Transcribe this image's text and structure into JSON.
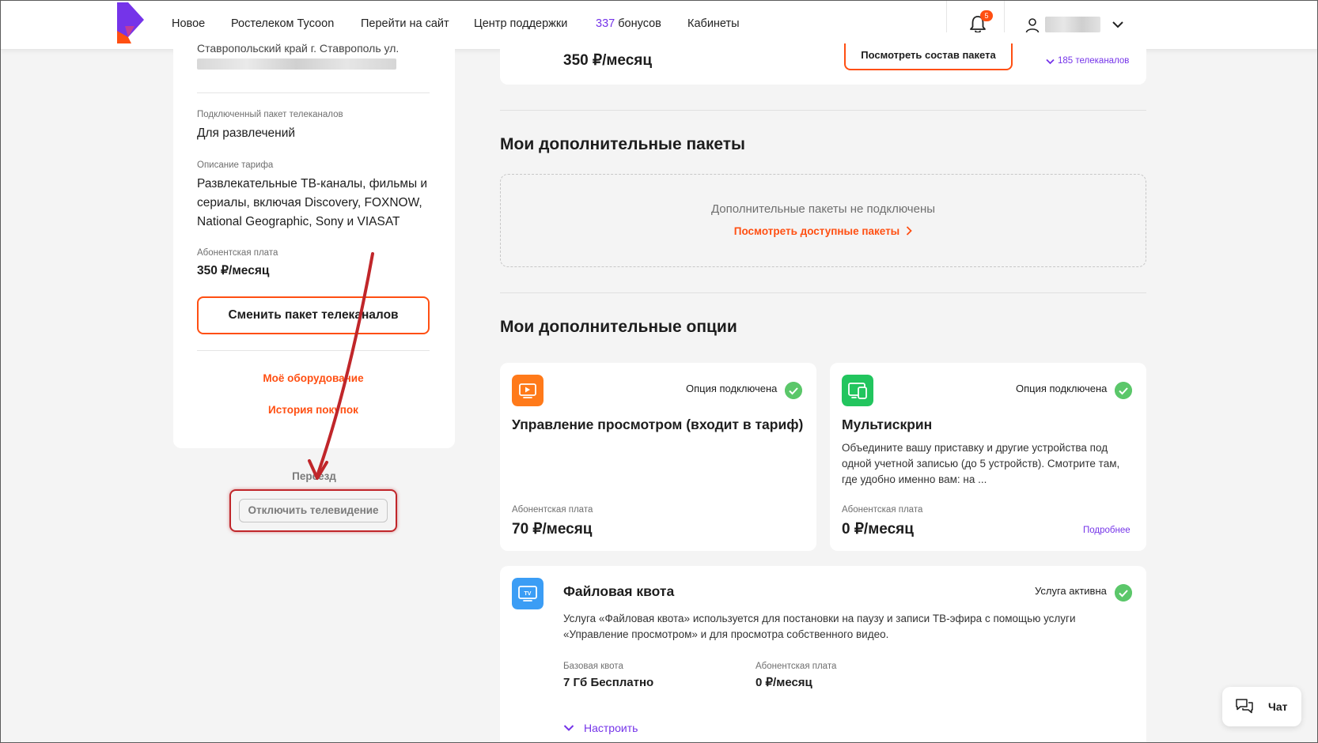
{
  "header": {
    "nav": [
      "Новое",
      "Ростелеком Tycoon",
      "Перейти на сайт",
      "Центр поддержки"
    ],
    "bonus_count": "337",
    "bonus_label": "бонусов",
    "cabinets": "Кабинеты",
    "notifications_badge": "5"
  },
  "sidebar": {
    "address_line": "Ставропольский край г. Ставрополь ул.",
    "package_label": "Подключенный пакет телеканалов",
    "package_value": "Для развлечений",
    "description_label": "Описание тарифа",
    "description_value": "Развлекательные ТВ-каналы, фильмы и сериалы, включая Discovery, FOXNOW, National Geographic, Sony и VIASAT",
    "fee_label": "Абонентская плата",
    "fee_value": "350 ₽/месяц",
    "change_button": "Сменить пакет телеканалов",
    "equipment_link": "Моё оборудование",
    "history_link": "История покупок",
    "move_link": "Переезд",
    "disable_button": "Отключить телевидение"
  },
  "top_card": {
    "price": "350 ₽/месяц",
    "composition_button": "Посмотреть состав пакета",
    "channels_link": "185 телеканалов"
  },
  "addons": {
    "title": "Мои дополнительные пакеты",
    "empty_text": "Дополнительные пакеты не подключены",
    "view_link": "Посмотреть доступные пакеты"
  },
  "options": {
    "title": "Мои дополнительные опции",
    "items": [
      {
        "status": "Опция подключена",
        "title": "Управление просмотром (входит в тариф)",
        "description": "",
        "fee_label": "Абонентская плата",
        "fee": "70 ₽/месяц",
        "icon": "play-screen-icon",
        "icon_color": "#ff7a1a"
      },
      {
        "status": "Опция подключена",
        "title": "Мультискрин",
        "description": "Объедините вашу приставку и другие устройства под одной учетной записью (до 5 устройств). Смотрите там, где удобно именно вам: на ...",
        "fee_label": "Абонентская плата",
        "fee": "0 ₽/месяц",
        "more": "Подробнее",
        "icon": "multiscreen-icon",
        "icon_color": "#22c55e"
      }
    ]
  },
  "quota": {
    "title": "Файловая квота",
    "status": "Услуга активна",
    "description": "Услуга «Файловая квота» используется для постановки на паузу и записи ТВ-эфира с помощью услуги «Управление просмотром» и для просмотра собственного видео.",
    "base_label": "Базовая квота",
    "base_value": "7 Гб Бесплатно",
    "fee_label": "Абонентская плата",
    "fee_value": "0 ₽/месяц",
    "configure": "Настроить",
    "icon": "tv-icon",
    "icon_color": "#3b9df5"
  },
  "chat": {
    "label": "Чат"
  },
  "colors": {
    "accent": "#ff4f12",
    "brand_purple": "#7534e9",
    "success": "#5bc76a",
    "annotation_red": "#c0262a"
  }
}
